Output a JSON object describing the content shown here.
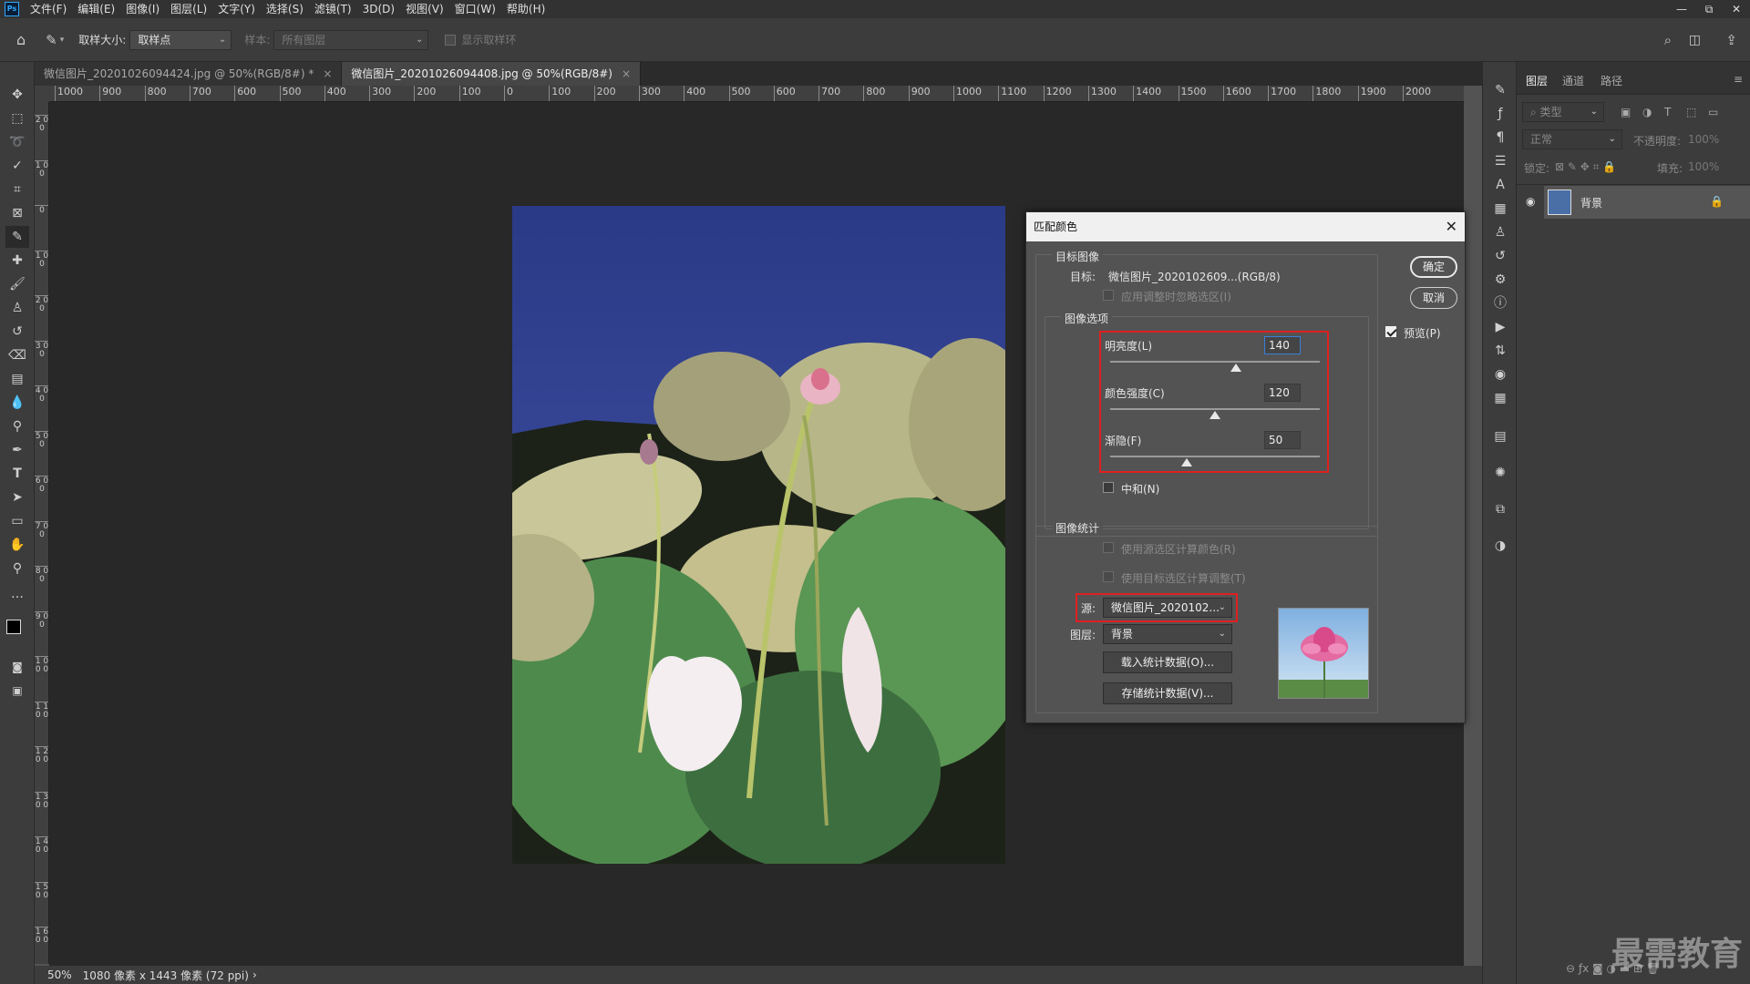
{
  "menubar": {
    "logo": "Ps",
    "items": [
      "文件(F)",
      "编辑(E)",
      "图像(I)",
      "图层(L)",
      "文字(Y)",
      "选择(S)",
      "滤镜(T)",
      "3D(D)",
      "视图(V)",
      "窗口(W)",
      "帮助(H)"
    ],
    "win_min": "—",
    "win_restore": "⧉",
    "win_close": "✕"
  },
  "optbar": {
    "sample_size_label": "取样大小:",
    "sample_size_value": "取样点",
    "sample_label": "样本:",
    "sample_value": "所有图层",
    "show_ring_label": "显示取样环"
  },
  "tabs": [
    {
      "label": "微信图片_20201026094424.jpg @ 50%(RGB/8#) *",
      "close": "×"
    },
    {
      "label": "微信图片_20201026094408.jpg @ 50%(RGB/8#)",
      "close": "×"
    }
  ],
  "hruler": [
    "1000",
    "900",
    "800",
    "700",
    "600",
    "500",
    "400",
    "300",
    "200",
    "100",
    "0",
    "100",
    "200",
    "300",
    "400",
    "500",
    "600",
    "700",
    "800",
    "900",
    "1000",
    "1100",
    "1200",
    "1300",
    "1400",
    "1500",
    "1600",
    "1700",
    "1800",
    "1900",
    "2000"
  ],
  "vruler": [
    "2 0 0",
    "1 0 0",
    "0",
    "1 0 0",
    "2 0 0",
    "3 0 0",
    "4 0 0",
    "5 0 0",
    "6 0 0",
    "7 0 0",
    "8 0 0",
    "9 0 0",
    "1 0 0 0",
    "1 1 0 0",
    "1 2 0 0",
    "1 3 0 0",
    "1 4 0 0",
    "1 5 0 0",
    "1 6 0 0"
  ],
  "status": {
    "zoom": "50%",
    "dims": "1080 像素 x 1443 像素 (72 ppi)",
    "arrow": "›"
  },
  "dialog": {
    "title": "匹配颜色",
    "close": "✕",
    "target_group": "目标图像",
    "target_label": "目标:",
    "target_value": "微信图片_2020102609...(RGB/8)",
    "ignore_selection": "应用调整时忽略选区(I)",
    "options_group": "图像选项",
    "luminance_label": "明亮度(L)",
    "luminance_value": "140",
    "luminance_pct": 0.6,
    "intensity_label": "颜色强度(C)",
    "intensity_value": "120",
    "intensity_pct": 0.5,
    "fade_label": "渐隐(F)",
    "fade_value": "50",
    "fade_pct": 0.5,
    "neutralize": "中和(N)",
    "ok": "确定",
    "cancel": "取消",
    "preview": "预览(P)",
    "stats_group": "图像统计",
    "use_source_sel": "使用源选区计算颜色(R)",
    "use_target_sel": "使用目标选区计算调整(T)",
    "source_label": "源:",
    "source_value": "微信图片_2020102...",
    "layer_label": "图层:",
    "layer_value": "背景",
    "load_stats": "载入统计数据(O)...",
    "save_stats": "存储统计数据(V)..."
  },
  "layers_panel": {
    "tabs": [
      "图层",
      "通道",
      "路径"
    ],
    "filter_placeholder": "类型",
    "blend_mode": "正常",
    "opacity_label": "不透明度:",
    "opacity_value": "100%",
    "lock_label": "锁定:",
    "fill_label": "填充:",
    "fill_value": "100%",
    "layer_name": "背景"
  },
  "watermark": "最需教育"
}
